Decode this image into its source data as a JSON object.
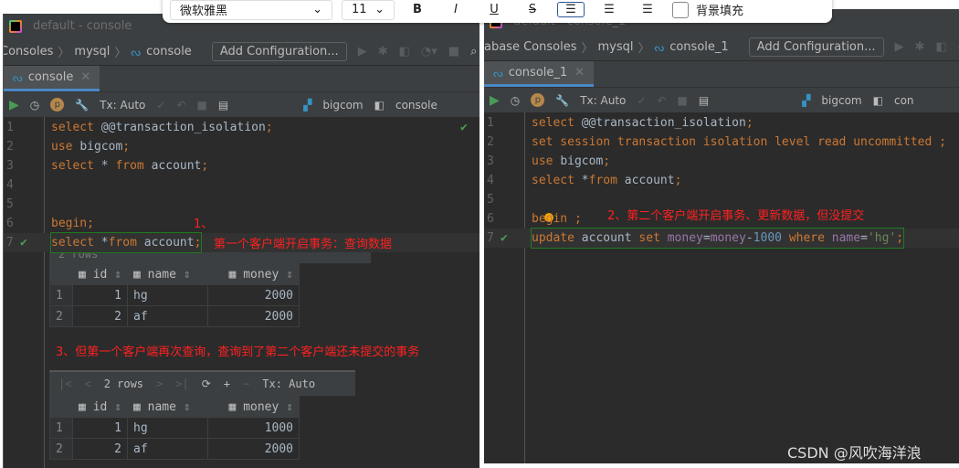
{
  "format_toolbar": {
    "font": "微软雅黑",
    "size": "11",
    "bold": "B",
    "italic": "I",
    "underline": "U",
    "strike": "S",
    "bg_fill_label": "背景填充"
  },
  "left": {
    "title": "default - console",
    "breadcrumb": [
      "Consoles",
      "mysql",
      "console"
    ],
    "add_config": "Add Configuration...",
    "tab": "console",
    "tx": "Tx: Auto",
    "schema": "bigcom",
    "session": "console",
    "lines": [
      {
        "n": "1",
        "seg": [
          [
            "select ",
            "kw"
          ],
          [
            "@@transaction_isolation",
            "id"
          ],
          [
            ";",
            "punc"
          ]
        ]
      },
      {
        "n": "2",
        "seg": [
          [
            "use ",
            "kw"
          ],
          [
            "bigcom",
            "id"
          ],
          [
            ";",
            "punc"
          ]
        ]
      },
      {
        "n": "3",
        "seg": [
          [
            "select ",
            "kw"
          ],
          [
            "* ",
            "id"
          ],
          [
            "from ",
            "kw"
          ],
          [
            "account",
            "id"
          ],
          [
            ";",
            "punc"
          ]
        ]
      },
      {
        "n": "4",
        "seg": []
      },
      {
        "n": "5",
        "seg": []
      },
      {
        "n": "6",
        "seg": [
          [
            "begin",
            "kw"
          ],
          [
            ";",
            "punc"
          ]
        ]
      },
      {
        "n": "7",
        "seg": [
          [
            "select ",
            "kw"
          ],
          [
            "*",
            "id"
          ],
          [
            "from ",
            "kw"
          ],
          [
            "account",
            "id"
          ],
          [
            ";",
            "punc"
          ]
        ]
      }
    ],
    "note1": "1、",
    "note1b": "第一个客户端开启事务：查询数据",
    "note3": "3、但第一个客户端再次查询，查询到了第二个客户端还未提交的事务",
    "columns": [
      "id",
      "name",
      "money"
    ],
    "result1": [
      [
        "1",
        "1",
        "hg",
        "2000"
      ],
      [
        "2",
        "2",
        "af",
        "2000"
      ]
    ],
    "rows_label": "2 rows",
    "result2": [
      [
        "1",
        "1",
        "hg",
        "1000"
      ],
      [
        "2",
        "2",
        "af",
        "2000"
      ]
    ]
  },
  "right": {
    "title": "default - console_1",
    "breadcrumb": [
      "abase Consoles",
      "mysql",
      "console_1"
    ],
    "add_config": "Add Configuration...",
    "tab": "console_1",
    "tx": "Tx: Auto",
    "schema": "bigcom",
    "session": "con",
    "lines": [
      {
        "n": "1",
        "seg": [
          [
            "select ",
            "kw"
          ],
          [
            "@@transaction_isolation",
            "id"
          ],
          [
            ";",
            "punc"
          ]
        ]
      },
      {
        "n": "2",
        "seg": [
          [
            "set session transaction isolation level read uncommitted ;",
            "kw"
          ]
        ]
      },
      {
        "n": "3",
        "seg": [
          [
            "use ",
            "kw"
          ],
          [
            "bigcom",
            "id"
          ],
          [
            ";",
            "punc"
          ]
        ]
      },
      {
        "n": "4",
        "seg": [
          [
            "select ",
            "kw"
          ],
          [
            "*",
            "id"
          ],
          [
            "from ",
            "kw"
          ],
          [
            "account",
            "id"
          ],
          [
            ";",
            "punc"
          ]
        ]
      },
      {
        "n": "5",
        "seg": []
      },
      {
        "n": "6",
        "seg": [
          [
            "begin ;",
            "kw"
          ]
        ]
      },
      {
        "n": "7",
        "seg": [
          [
            "update ",
            "kw"
          ],
          [
            "account ",
            "id"
          ],
          [
            "set ",
            "kw"
          ],
          [
            "money",
            "col"
          ],
          [
            "=",
            "id"
          ],
          [
            "money",
            "col"
          ],
          [
            "-",
            "id"
          ],
          [
            "1000 ",
            "num"
          ],
          [
            "where ",
            "kw"
          ],
          [
            "name",
            "col"
          ],
          [
            "=",
            "id"
          ],
          [
            "'hg'",
            "str"
          ],
          [
            ";",
            "punc"
          ]
        ]
      }
    ],
    "note2": "2、第二个客户端开启事务、更新数据，但没提交"
  },
  "watermark": "CSDN @风吹海洋浪"
}
